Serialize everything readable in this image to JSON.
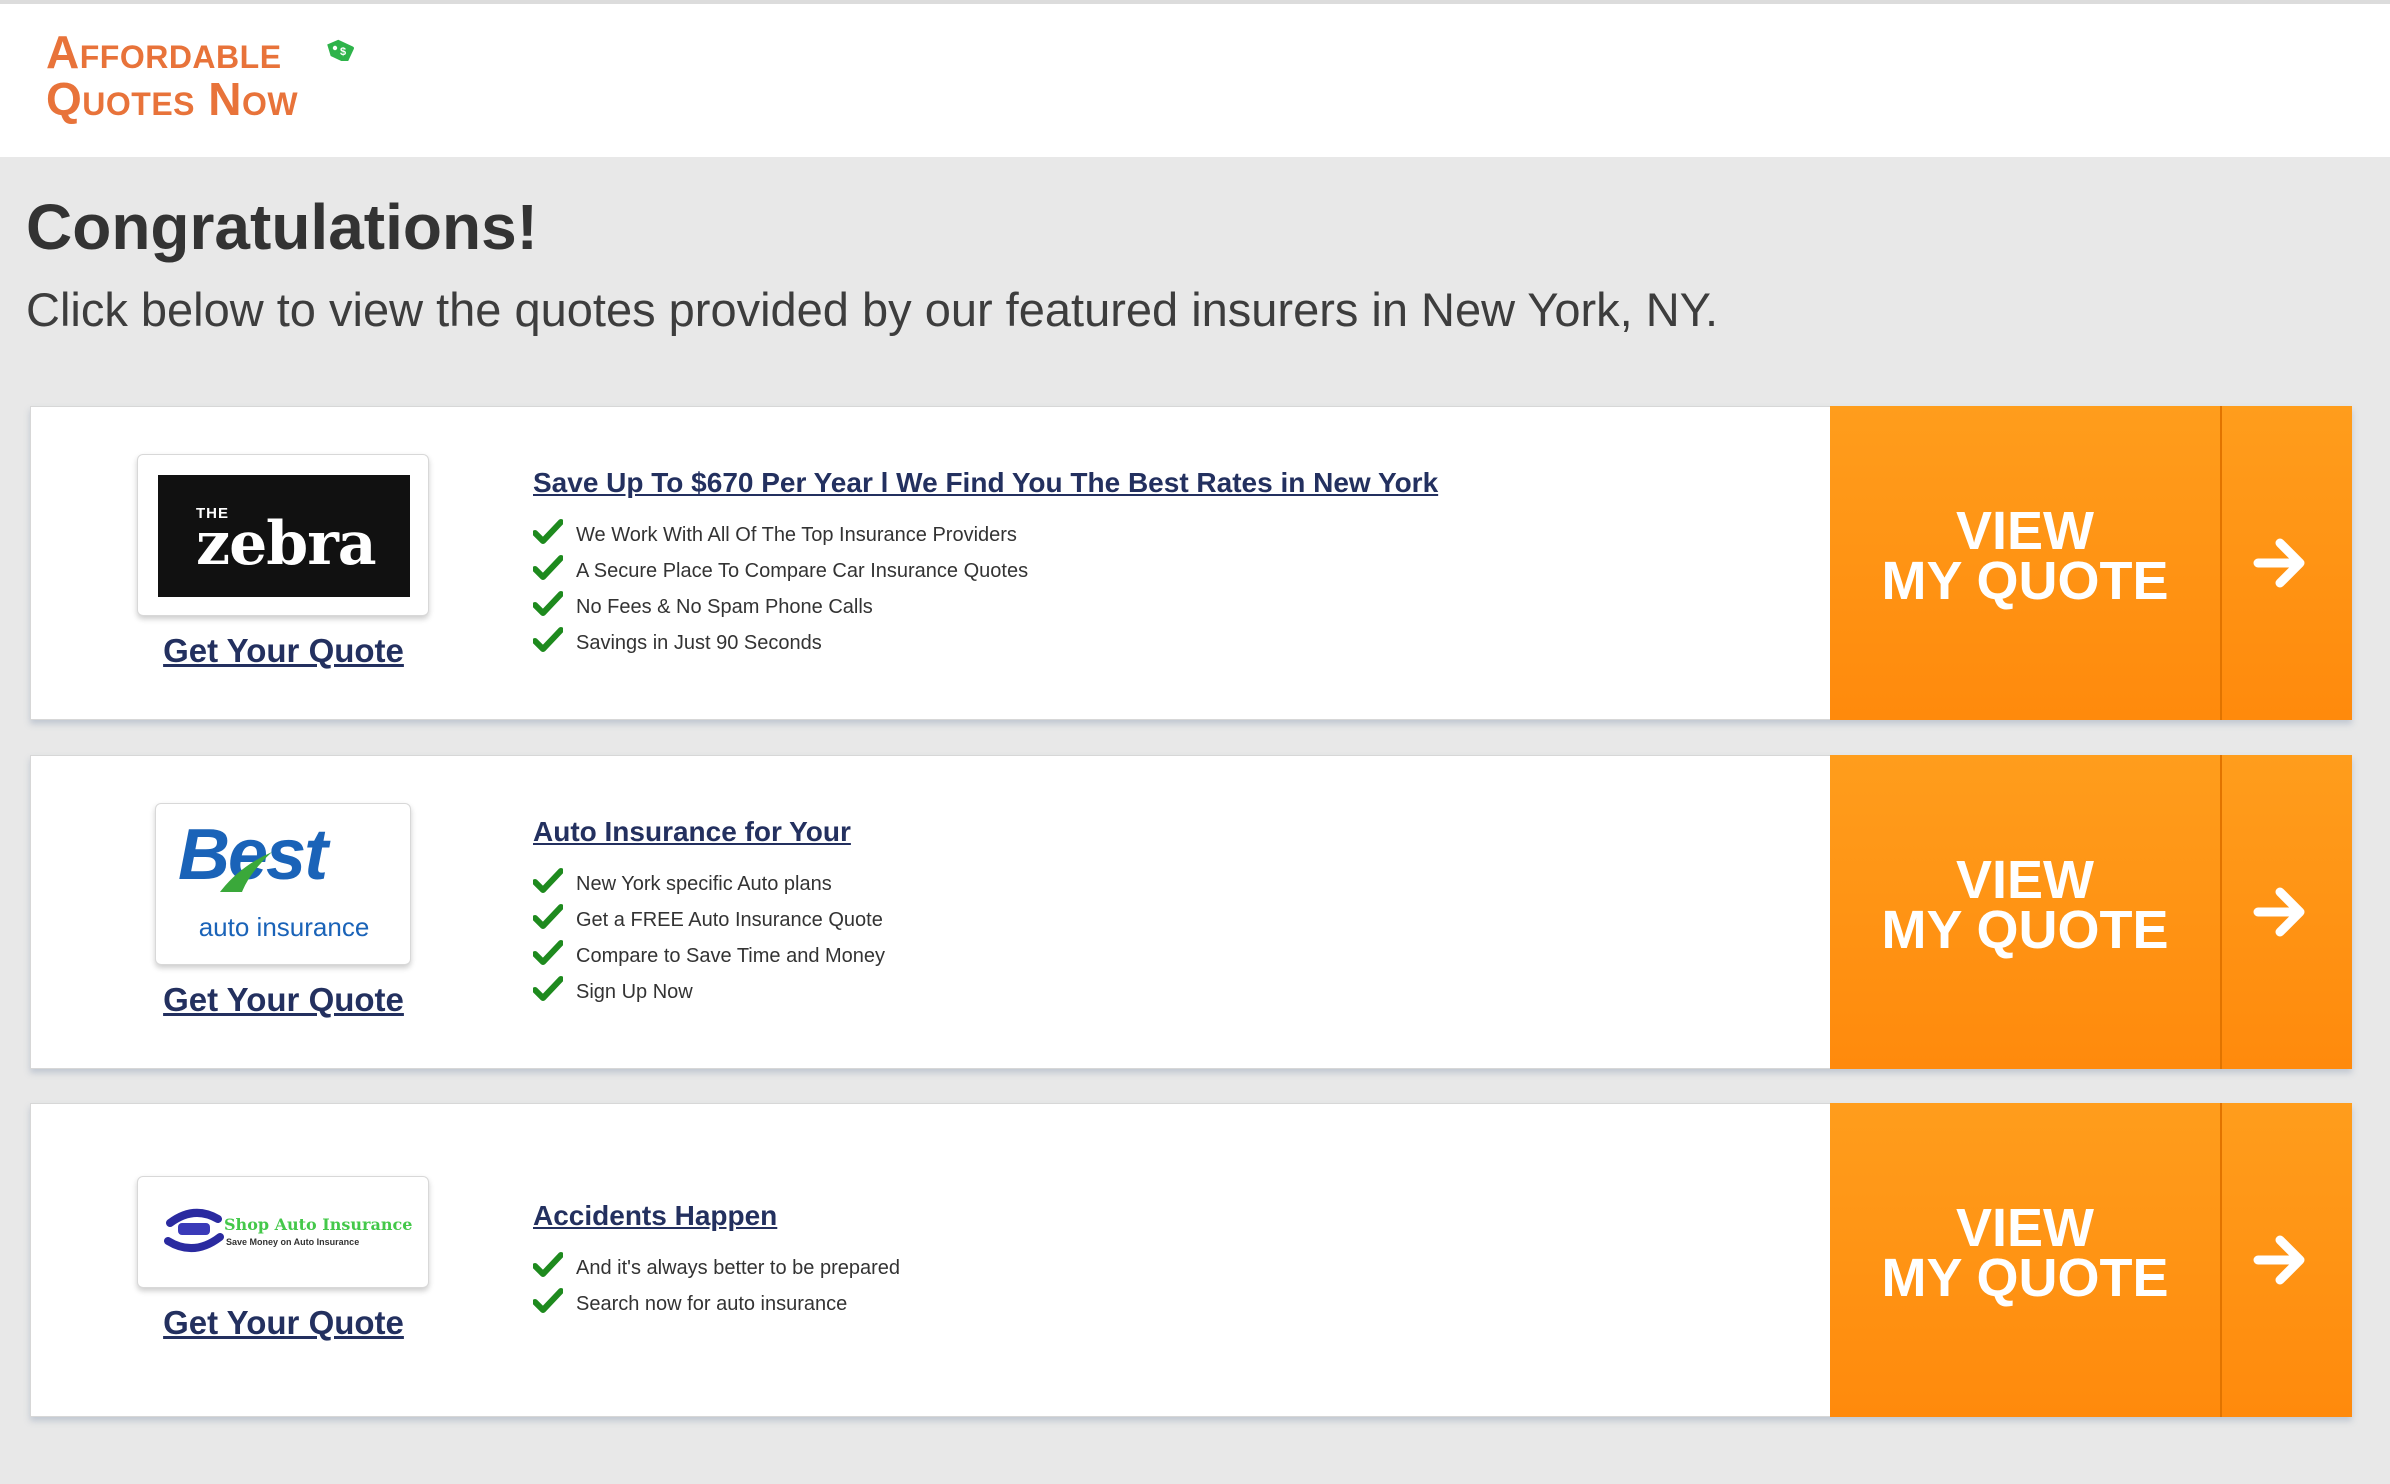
{
  "brand": {
    "line1": "Affordable",
    "line2": "Quotes Now",
    "color": "#e8733a",
    "tag_color": "#2eb34a"
  },
  "hero": {
    "title": "Congratulations!",
    "subtitle": "Click below to view the quotes provided by our featured insurers in New York, NY."
  },
  "cta": {
    "line1": "VIEW",
    "line2": "MY QUOTE",
    "color": "#ff8f10",
    "arrow_icon": "arrow-right-icon"
  },
  "offers": [
    {
      "logo_text_small": "THE",
      "logo_text": "zebra",
      "link": "Get Your Quote",
      "title": "Save Up To $670 Per Year l We Find You The Best Rates in New York",
      "bullets": [
        "We Work With All Of The Top Insurance Providers",
        "A Secure Place To Compare Car Insurance Quotes",
        "No Fees & No Spam Phone Calls",
        "Savings in Just 90 Seconds"
      ]
    },
    {
      "logo_text": "Best",
      "logo_sub": "auto insurance",
      "link": "Get Your Quote",
      "title": "Auto Insurance for Your",
      "bullets": [
        "New York specific Auto plans",
        "Get a FREE Auto Insurance Quote",
        "Compare to Save Time and Money",
        "Sign Up Now"
      ]
    },
    {
      "logo_text": "Shop Auto Insurance",
      "logo_sub": "Save Money on Auto Insurance",
      "link": "Get Your Quote",
      "title": "Accidents Happen",
      "bullets": [
        "And it's always better to be prepared",
        "Search now for auto insurance"
      ]
    }
  ]
}
